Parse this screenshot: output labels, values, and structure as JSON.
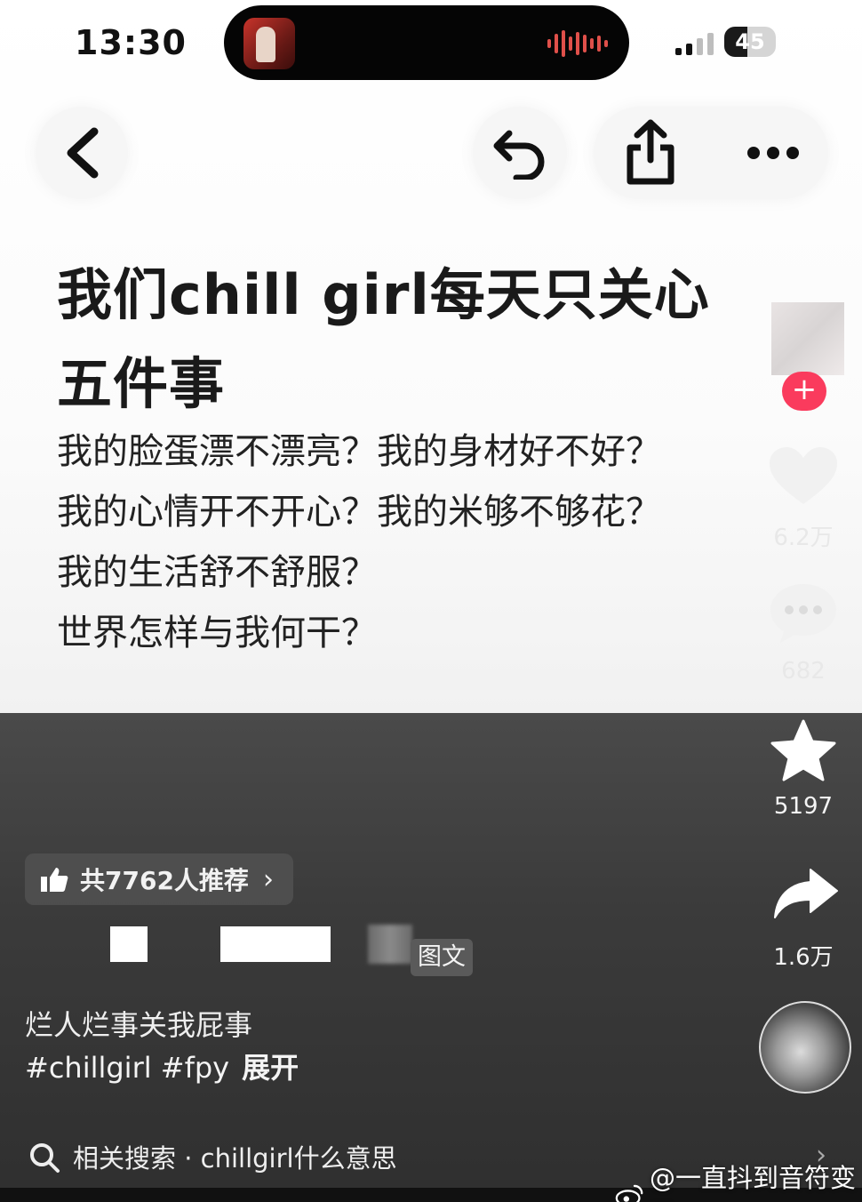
{
  "status_bar": {
    "time": "13:30",
    "battery": "45",
    "battery_level": 0.45
  },
  "nav": {
    "back_icon": "chevron-left-icon",
    "undo_icon": "undo-icon",
    "share_icon": "share-icon",
    "more_icon": "more-icon"
  },
  "post": {
    "title_line1": "我们chill girl每天只关心",
    "title_line2": "五件事",
    "lines": [
      "我的脸蛋漂不漂亮？我的身材好不好？",
      "我的心情开不开心？我的米够不够花？",
      "我的生活舒不舒服？",
      "世界怎样与我何干？"
    ]
  },
  "rail": {
    "follow_plus": "+",
    "like_count": "6.2万",
    "comment_count": "682",
    "favorite_count": "5197",
    "share_count": "1.6万"
  },
  "meta": {
    "recommend_text": "共7762人推荐",
    "recommend_chevron": "›",
    "type_tag": "图文",
    "caption": "烂人烂事关我屁事",
    "hashtags": "#chillgirl #fpy",
    "expand": "展开"
  },
  "search": {
    "label": "相关搜索 · chillgirl什么意思",
    "arrow": "›"
  },
  "watermark": {
    "text": "@一直抖到音符变黑"
  },
  "colors": {
    "accent_red": "#fa3b5d",
    "dark_panel": "#3b3b3b"
  }
}
